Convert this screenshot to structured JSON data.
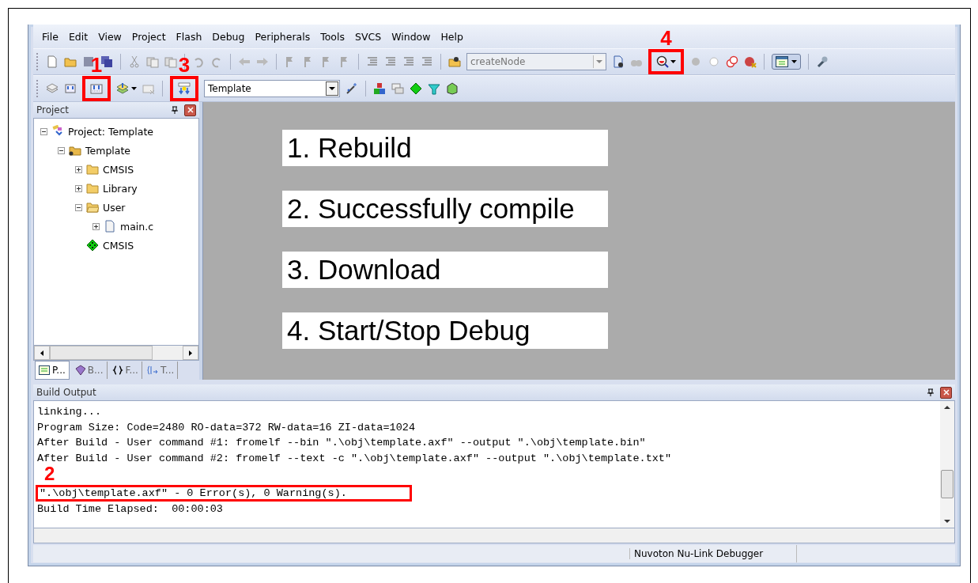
{
  "menu": [
    "File",
    "Edit",
    "View",
    "Project",
    "Flash",
    "Debug",
    "Peripherals",
    "Tools",
    "SVCS",
    "Window",
    "Help"
  ],
  "toolbar": {
    "find_combo": {
      "value": "createNode",
      "disabled": true
    },
    "target_combo": {
      "value": "Template"
    }
  },
  "callouts": [
    {
      "label": "1"
    },
    {
      "label": "3"
    },
    {
      "label": "4"
    },
    {
      "label": "2"
    }
  ],
  "project_panel": {
    "title": "Project",
    "tree": [
      {
        "label": "Project: Template",
        "kind": "project",
        "expanded": true,
        "children": [
          {
            "label": "Template",
            "kind": "target",
            "expanded": true,
            "children": [
              {
                "label": "CMSIS",
                "kind": "folder",
                "expanded": false
              },
              {
                "label": "Library",
                "kind": "folder",
                "expanded": false
              },
              {
                "label": "User",
                "kind": "folder",
                "expanded": true,
                "children": [
                  {
                    "label": "main.c",
                    "kind": "file",
                    "expanded": false
                  }
                ]
              },
              {
                "label": "CMSIS",
                "kind": "component"
              }
            ]
          }
        ]
      }
    ],
    "tabs": [
      {
        "label": "P...",
        "selected": true
      },
      {
        "label": "B...",
        "selected": false
      },
      {
        "label": "F...",
        "selected": false
      },
      {
        "label": "T...",
        "selected": false
      }
    ]
  },
  "steps": [
    "1. Rebuild",
    "2. Successfully compile",
    "3. Download",
    "4. Start/Stop Debug"
  ],
  "build_output": {
    "title": "Build Output",
    "lines": [
      {
        "text": "linking...",
        "highlighted": false
      },
      {
        "text": "Program Size: Code=2480 RO-data=372 RW-data=16 ZI-data=1024",
        "highlighted": false
      },
      {
        "text": "After Build - User command #1: fromelf --bin \".\\obj\\template.axf\" --output \".\\obj\\template.bin\"",
        "highlighted": false
      },
      {
        "text": "After Build - User command #2: fromelf --text -c \".\\obj\\template.axf\" --output \".\\obj\\template.txt\"",
        "highlighted": false
      },
      {
        "text": "\".\\obj\\template.axf\" - 0 Error(s), 0 Warning(s).",
        "highlighted": true
      },
      {
        "text": "Build Time Elapsed:  00:00:03",
        "highlighted": false
      }
    ]
  },
  "status_bar": {
    "debugger": "Nuvoton Nu-Link Debugger"
  }
}
